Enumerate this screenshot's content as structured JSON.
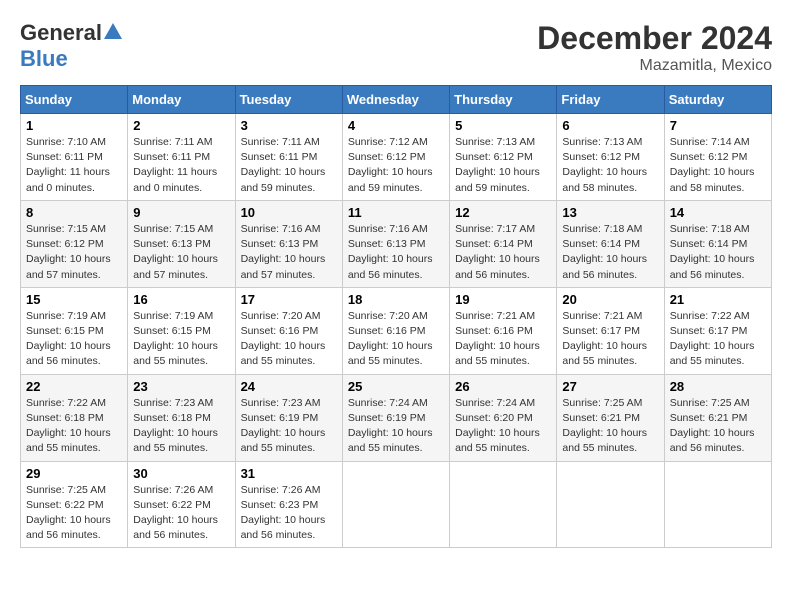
{
  "header": {
    "logo_general": "General",
    "logo_blue": "Blue",
    "month": "December 2024",
    "location": "Mazamitla, Mexico"
  },
  "weekdays": [
    "Sunday",
    "Monday",
    "Tuesday",
    "Wednesday",
    "Thursday",
    "Friday",
    "Saturday"
  ],
  "weeks": [
    [
      {
        "day": "1",
        "sunrise": "7:10 AM",
        "sunset": "6:11 PM",
        "daylight": "11 hours and 0 minutes."
      },
      {
        "day": "2",
        "sunrise": "7:11 AM",
        "sunset": "6:11 PM",
        "daylight": "11 hours and 0 minutes."
      },
      {
        "day": "3",
        "sunrise": "7:11 AM",
        "sunset": "6:11 PM",
        "daylight": "10 hours and 59 minutes."
      },
      {
        "day": "4",
        "sunrise": "7:12 AM",
        "sunset": "6:12 PM",
        "daylight": "10 hours and 59 minutes."
      },
      {
        "day": "5",
        "sunrise": "7:13 AM",
        "sunset": "6:12 PM",
        "daylight": "10 hours and 59 minutes."
      },
      {
        "day": "6",
        "sunrise": "7:13 AM",
        "sunset": "6:12 PM",
        "daylight": "10 hours and 58 minutes."
      },
      {
        "day": "7",
        "sunrise": "7:14 AM",
        "sunset": "6:12 PM",
        "daylight": "10 hours and 58 minutes."
      }
    ],
    [
      {
        "day": "8",
        "sunrise": "7:15 AM",
        "sunset": "6:12 PM",
        "daylight": "10 hours and 57 minutes."
      },
      {
        "day": "9",
        "sunrise": "7:15 AM",
        "sunset": "6:13 PM",
        "daylight": "10 hours and 57 minutes."
      },
      {
        "day": "10",
        "sunrise": "7:16 AM",
        "sunset": "6:13 PM",
        "daylight": "10 hours and 57 minutes."
      },
      {
        "day": "11",
        "sunrise": "7:16 AM",
        "sunset": "6:13 PM",
        "daylight": "10 hours and 56 minutes."
      },
      {
        "day": "12",
        "sunrise": "7:17 AM",
        "sunset": "6:14 PM",
        "daylight": "10 hours and 56 minutes."
      },
      {
        "day": "13",
        "sunrise": "7:18 AM",
        "sunset": "6:14 PM",
        "daylight": "10 hours and 56 minutes."
      },
      {
        "day": "14",
        "sunrise": "7:18 AM",
        "sunset": "6:14 PM",
        "daylight": "10 hours and 56 minutes."
      }
    ],
    [
      {
        "day": "15",
        "sunrise": "7:19 AM",
        "sunset": "6:15 PM",
        "daylight": "10 hours and 56 minutes."
      },
      {
        "day": "16",
        "sunrise": "7:19 AM",
        "sunset": "6:15 PM",
        "daylight": "10 hours and 55 minutes."
      },
      {
        "day": "17",
        "sunrise": "7:20 AM",
        "sunset": "6:16 PM",
        "daylight": "10 hours and 55 minutes."
      },
      {
        "day": "18",
        "sunrise": "7:20 AM",
        "sunset": "6:16 PM",
        "daylight": "10 hours and 55 minutes."
      },
      {
        "day": "19",
        "sunrise": "7:21 AM",
        "sunset": "6:16 PM",
        "daylight": "10 hours and 55 minutes."
      },
      {
        "day": "20",
        "sunrise": "7:21 AM",
        "sunset": "6:17 PM",
        "daylight": "10 hours and 55 minutes."
      },
      {
        "day": "21",
        "sunrise": "7:22 AM",
        "sunset": "6:17 PM",
        "daylight": "10 hours and 55 minutes."
      }
    ],
    [
      {
        "day": "22",
        "sunrise": "7:22 AM",
        "sunset": "6:18 PM",
        "daylight": "10 hours and 55 minutes."
      },
      {
        "day": "23",
        "sunrise": "7:23 AM",
        "sunset": "6:18 PM",
        "daylight": "10 hours and 55 minutes."
      },
      {
        "day": "24",
        "sunrise": "7:23 AM",
        "sunset": "6:19 PM",
        "daylight": "10 hours and 55 minutes."
      },
      {
        "day": "25",
        "sunrise": "7:24 AM",
        "sunset": "6:19 PM",
        "daylight": "10 hours and 55 minutes."
      },
      {
        "day": "26",
        "sunrise": "7:24 AM",
        "sunset": "6:20 PM",
        "daylight": "10 hours and 55 minutes."
      },
      {
        "day": "27",
        "sunrise": "7:25 AM",
        "sunset": "6:21 PM",
        "daylight": "10 hours and 55 minutes."
      },
      {
        "day": "28",
        "sunrise": "7:25 AM",
        "sunset": "6:21 PM",
        "daylight": "10 hours and 56 minutes."
      }
    ],
    [
      {
        "day": "29",
        "sunrise": "7:25 AM",
        "sunset": "6:22 PM",
        "daylight": "10 hours and 56 minutes."
      },
      {
        "day": "30",
        "sunrise": "7:26 AM",
        "sunset": "6:22 PM",
        "daylight": "10 hours and 56 minutes."
      },
      {
        "day": "31",
        "sunrise": "7:26 AM",
        "sunset": "6:23 PM",
        "daylight": "10 hours and 56 minutes."
      },
      null,
      null,
      null,
      null
    ]
  ]
}
